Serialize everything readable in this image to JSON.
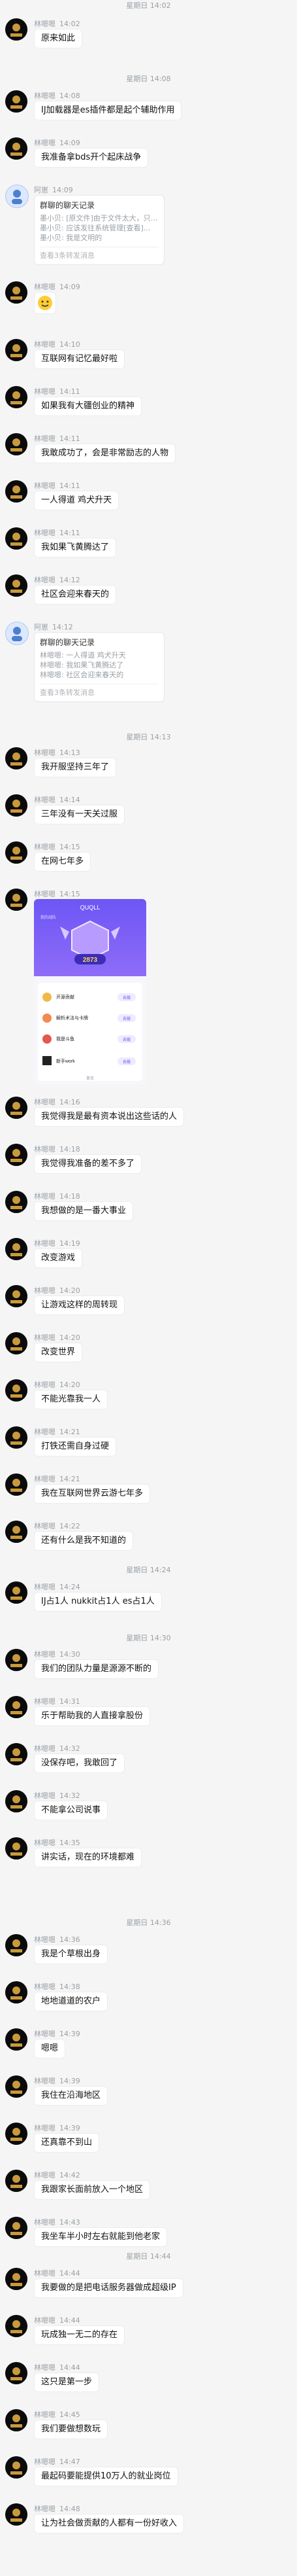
{
  "messages": [
    {
      "sender": "林嗯嗯",
      "time": "14:02",
      "text": "原来如此"
    },
    {
      "sender": "林嗯嗯",
      "time": "14:08",
      "text": "IJ加载器是es插件都是起个辅助作用"
    },
    {
      "sender": "林嗯嗯",
      "time": "14:09",
      "text": "我准备拿bds开个起床战争"
    },
    {
      "sender": "阿崽",
      "time": "14:09",
      "title": "群聊的聊天记录",
      "lines": [
        "墨小贝: [原文件]由于文件太大，只能下载...",
        "墨小贝: 应该发往系统管理[查看]...",
        "墨小贝: 我是文明的"
      ],
      "foot": "查看3条转发消息"
    },
    {
      "sender": "林嗯嗯",
      "time": "14:09",
      "text": ""
    },
    {
      "sender": "林嗯嗯",
      "time": "14:10",
      "text": "互联网有记忆最好啦"
    },
    {
      "sender": "林嗯嗯",
      "time": "14:11",
      "text": "如果我有大疆创业的精神"
    },
    {
      "sender": "林嗯嗯",
      "time": "14:11",
      "text": "我敢成功了，会是非常励志的人物"
    },
    {
      "sender": "林嗯嗯",
      "time": "14:11",
      "text": "一人得道 鸡犬升天"
    },
    {
      "sender": "林嗯嗯",
      "time": "14:11",
      "text": "我如果飞黄腾达了"
    },
    {
      "sender": "林嗯嗯",
      "time": "14:12",
      "text": "社区会迎来春天的"
    },
    {
      "sender": "阿崽",
      "time": "14:12",
      "title": "群聊的聊天记录",
      "lines": [
        "林嗯嗯: 一人得道 鸡犬升天",
        "林嗯嗯: 我如果飞黄腾达了",
        "林嗯嗯: 社区会迎来春天的"
      ],
      "foot": "查看3条转发消息"
    },
    {
      "sender": "林嗯嗯",
      "time": "14:13",
      "text": "我开服坚持三年了"
    },
    {
      "sender": "林嗯嗯",
      "time": "14:14",
      "text": "三年没有一天关过服"
    },
    {
      "sender": "林嗯嗯",
      "time": "14:15",
      "text": "在网七年多"
    },
    {
      "sender": "林嗯嗯",
      "time": "14:15",
      "text": ""
    },
    {
      "sender": "林嗯嗯",
      "time": "14:16",
      "text": "我觉得我是最有资本说出这些话的人"
    },
    {
      "sender": "林嗯嗯",
      "time": "14:18",
      "text": "我觉得我准备的差不多了"
    },
    {
      "sender": "林嗯嗯",
      "time": "14:18",
      "text": "我想做的是一番大事业"
    },
    {
      "sender": "林嗯嗯",
      "time": "14:19",
      "text": "改变游戏"
    },
    {
      "sender": "林嗯嗯",
      "time": "14:20",
      "text": "让游戏这样的周转现"
    },
    {
      "sender": "林嗯嗯",
      "time": "14:20",
      "text": "改变世界"
    },
    {
      "sender": "林嗯嗯",
      "time": "14:20",
      "text": "不能光靠我一人"
    },
    {
      "sender": "林嗯嗯",
      "time": "14:21",
      "text": "打铁还需自身过硬"
    },
    {
      "sender": "林嗯嗯",
      "time": "14:21",
      "text": "我在互联网世界云游七年多"
    },
    {
      "sender": "林嗯嗯",
      "time": "14:22",
      "text": "还有什么是我不知道的"
    },
    {
      "sender": "林嗯嗯",
      "time": "14:24",
      "text": "IJ占1人 nukkit占1人 es占1人"
    },
    {
      "sender": "林嗯嗯",
      "time": "14:30",
      "text": "我们的团队力量是源源不断的"
    },
    {
      "sender": "林嗯嗯",
      "time": "14:31",
      "text": "乐于帮助我的人直接拿股份"
    },
    {
      "sender": "林嗯嗯",
      "time": "14:32",
      "text": "没保存吧，我敢回了"
    },
    {
      "sender": "林嗯嗯",
      "time": "14:32",
      "text": "不能拿公司说事"
    },
    {
      "sender": "林嗯嗯",
      "time": "14:35",
      "text": "讲实话，现在的环境都难"
    },
    {
      "sender": "林嗯嗯",
      "time": "14:36",
      "text": "我是个草根出身"
    },
    {
      "sender": "林嗯嗯",
      "time": "14:38",
      "text": "地地道道的农户"
    },
    {
      "sender": "林嗯嗯",
      "time": "14:39",
      "text": "嗯嗯"
    },
    {
      "sender": "林嗯嗯",
      "time": "14:39",
      "text": "我住在沿海地区"
    },
    {
      "sender": "林嗯嗯",
      "time": "14:39",
      "text": "还真靠不到山"
    },
    {
      "sender": "林嗯嗯",
      "time": "14:42",
      "text": "我跟家长面前放入一个地区"
    },
    {
      "sender": "林嗯嗯",
      "time": "14:43",
      "text": "我坐车半小时左右就能到他老家"
    },
    {
      "sender": "林嗯嗯",
      "time": "14:44",
      "text": "我要做的是把电话服务器做成超级IP"
    },
    {
      "sender": "林嗯嗯",
      "time": "14:44",
      "text": "玩成独一无二的存在"
    },
    {
      "sender": "林嗯嗯",
      "time": "14:44",
      "text": "这只是第一步"
    },
    {
      "sender": "林嗯嗯",
      "time": "14:45",
      "text": "我们要做想数玩"
    },
    {
      "sender": "林嗯嗯",
      "time": "14:47",
      "text": "最起码要能提供10万人的就业岗位"
    },
    {
      "sender": "林嗯嗯",
      "time": "14:48",
      "text": "让为社会做贡献的人都有一份好收入"
    }
  ],
  "timestamps": [
    "星期日 14:02",
    "星期日 14:08",
    "星期日 14:13",
    "星期日 14:24",
    "星期日 14:30",
    "星期日 14:36",
    "星期日 14:44"
  ],
  "screenshot": {
    "app_name": "QUQLL",
    "header_text": "我的战队",
    "score": "2873",
    "list": [
      {
        "label": "开源贡献",
        "action": "去做"
      },
      {
        "label": "解析术法与卡牌",
        "action": "去做"
      },
      {
        "label": "我是斗鱼",
        "action": "去做"
      },
      {
        "label": "新手work",
        "action": "去做"
      }
    ],
    "bottom_tab": "首页"
  }
}
